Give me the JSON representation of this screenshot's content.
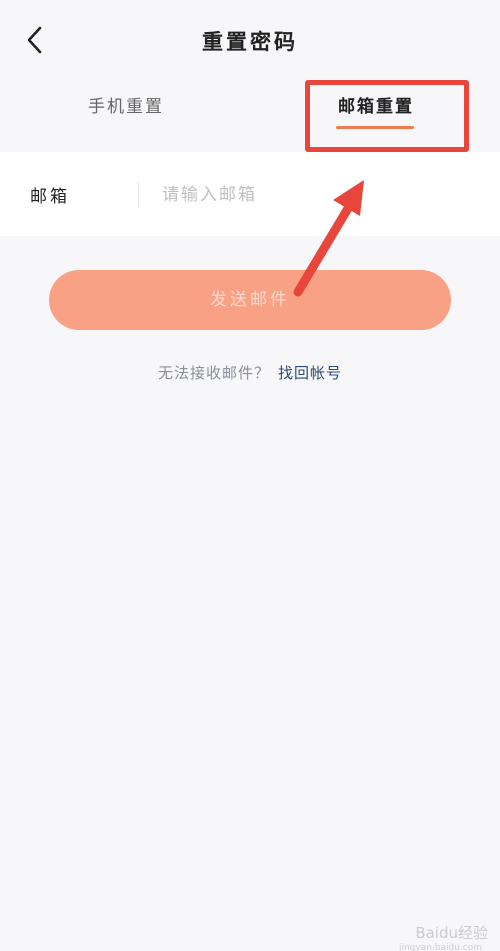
{
  "header": {
    "title": "重置密码",
    "back_icon": "chevron-left-icon"
  },
  "tabs": [
    {
      "label": "手机重置",
      "active": false
    },
    {
      "label": "邮箱重置",
      "active": true
    }
  ],
  "form": {
    "email_label": "邮箱",
    "email_placeholder": "请输入邮箱",
    "email_value": ""
  },
  "send_button": {
    "label": "发送邮件",
    "color": "#f9a184"
  },
  "help": {
    "text": "无法接收邮件？",
    "link": "找回帐号"
  },
  "annotation": {
    "color": "#e8463d"
  },
  "watermark": {
    "text": "Baidu经验",
    "sub": "jingyan.baidu.com"
  },
  "colors": {
    "accent": "#f27b52",
    "background": "#f7f6f8",
    "link": "#2b4a73"
  }
}
